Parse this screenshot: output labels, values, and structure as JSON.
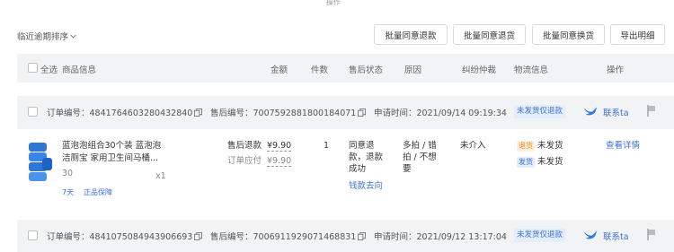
{
  "top_partial_text": "操作",
  "sort": {
    "label": "临近逾期排序"
  },
  "toolbar": {
    "batch_refund": "批量同意退款",
    "batch_return": "批量同意退货",
    "batch_exchange": "批量同意换货",
    "export": "导出明细"
  },
  "table_header": {
    "select_all": "全选",
    "product_info": "商品信息",
    "amount": "金额",
    "quantity": "件数",
    "aftersale_status": "售后状态",
    "reason": "原因",
    "dispute": "纠纷仲裁",
    "logistics": "物流信息",
    "actions": "操作"
  },
  "orders": [
    {
      "order_no": "订单编号：4841764603280432840",
      "aftersale_no": "售后编号：7007592881800184071",
      "apply_time": "申请时间：2021/09/14 09:19:34",
      "type_tag": "未发货仅退款",
      "contact": "联系ta"
    },
    {
      "order_no": "订单编号：4841075084943906693",
      "aftersale_no": "售后编号：7006911929071468831",
      "apply_time": "申请时间：2021/09/12 13:17:04",
      "type_tag": "未发货仅退款",
      "contact": "联系ta"
    }
  ],
  "item": {
    "title_line1": "蓝泡泡组合30个装 蓝泡泡",
    "title_line2": "洁厕宝 家用卫生间马桶...",
    "spec": "30",
    "qty_x": "x1",
    "tag_days": "7天",
    "tag_genuine": "正品保障",
    "refund_label": "售后退款",
    "refund_amount": "¥9.90",
    "payable_label": "订单应付",
    "payable_amount": "¥9.90",
    "count": "1",
    "status_line1": "同意退",
    "status_line2": "款，退款",
    "status_line3": "成功",
    "refund_trace": "钱款去向",
    "reason_line1": "多拍 / 错",
    "reason_line2": "拍 / 不想",
    "reason_line3": "要",
    "dispute": "未介入",
    "logi_return_badge": "退货",
    "logi_return_text": "未发货",
    "logi_ship_badge": "发货",
    "logi_ship_text": "未发货",
    "view_detail": "查看详情"
  },
  "colors": {
    "accent": "#3b6fd6",
    "header_bg": "#f2f3f5",
    "orange": "#f08a24"
  }
}
